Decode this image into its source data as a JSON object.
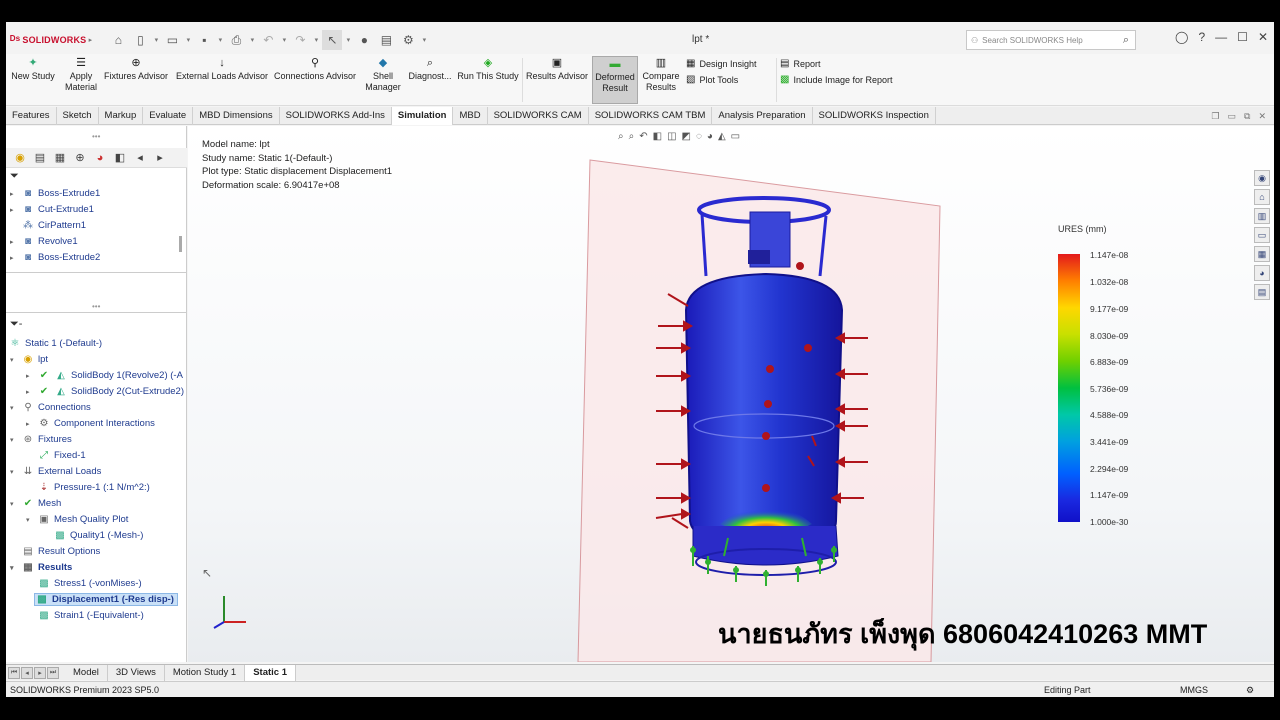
{
  "app": {
    "brand": "SOLIDWORKS",
    "doc_title": "lpt *",
    "search_placeholder": "Search SOLIDWORKS Help"
  },
  "commands": [
    {
      "label": "New Study",
      "icon": "new-study-icon"
    },
    {
      "label": "Apply Material",
      "icon": "apply-material-icon"
    },
    {
      "label": "Fixtures Advisor",
      "icon": "fixtures-advisor-icon"
    },
    {
      "label": "External Loads Advisor",
      "icon": "external-loads-icon"
    },
    {
      "label": "Connections Advisor",
      "icon": "connections-advisor-icon"
    },
    {
      "label": "Shell Manager",
      "icon": "shell-manager-icon"
    },
    {
      "label": "Diagnost...",
      "icon": "diagnostics-icon"
    },
    {
      "label": "Run This Study",
      "icon": "run-study-icon"
    },
    {
      "label": "Results Advisor",
      "icon": "results-advisor-icon"
    },
    {
      "label": "Deformed Result",
      "icon": "deformed-result-icon"
    },
    {
      "label": "Compare Results",
      "icon": "compare-results-icon"
    }
  ],
  "cmd_side": {
    "design_insight": "Design Insight",
    "plot_tools": "Plot Tools",
    "report": "Report",
    "include_image": "Include Image for Report"
  },
  "tabs": [
    "Features",
    "Sketch",
    "Markup",
    "Evaluate",
    "MBD Dimensions",
    "SOLIDWORKS Add-Ins",
    "Simulation",
    "MBD",
    "SOLIDWORKS CAM",
    "SOLIDWORKS CAM TBM",
    "Analysis Preparation",
    "SOLIDWORKS Inspection"
  ],
  "feature_tree": [
    "Boss-Extrude1",
    "Cut-Extrude1",
    "CirPattern1",
    "Revolve1",
    "Boss-Extrude2"
  ],
  "sim_tree": {
    "study": "Static 1 (-Default-)",
    "part": "lpt",
    "body1": "SolidBody 1(Revolve2) (-A",
    "body2": "SolidBody 2(Cut-Extrude2)",
    "connections": "Connections",
    "component_interactions": "Component Interactions",
    "fixtures": "Fixtures",
    "fixed": "Fixed-1",
    "external_loads": "External Loads",
    "pressure": "Pressure-1 (:1 N/m^2:)",
    "mesh": "Mesh",
    "mesh_quality": "Mesh Quality Plot",
    "quality1": "Quality1 (-Mesh-)",
    "result_options": "Result Options",
    "results": "Results",
    "stress": "Stress1 (-vonMises-)",
    "displacement": "Displacement1 (-Res disp-)",
    "strain": "Strain1 (-Equivalent-)"
  },
  "info": {
    "model": "Model name: lpt",
    "study": "Study name: Static 1(-Default-)",
    "plot_type": "Plot type: Static displacement Displacement1",
    "deformation": "Deformation scale: 6.90417e+08"
  },
  "legend": {
    "title": "URES (mm)",
    "labels": [
      "1.147e-08",
      "1.032e-08",
      "9.177e-09",
      "8.030e-09",
      "6.883e-09",
      "5.736e-09",
      "4.588e-09",
      "3.441e-09",
      "2.294e-09",
      "1.147e-09",
      "1.000e-30"
    ]
  },
  "watermark": "นายธนภัทร เพ็งพุด 6806042410263 MMT",
  "bottom_tabs": [
    "Model",
    "3D Views",
    "Motion Study 1",
    "Static 1"
  ],
  "status": {
    "left": "SOLIDWORKS Premium 2023 SP5.0",
    "mode": "Editing Part",
    "units": "MMGS"
  },
  "colors": {
    "brand": "#c8102e",
    "selection": "#c9e0f7"
  }
}
